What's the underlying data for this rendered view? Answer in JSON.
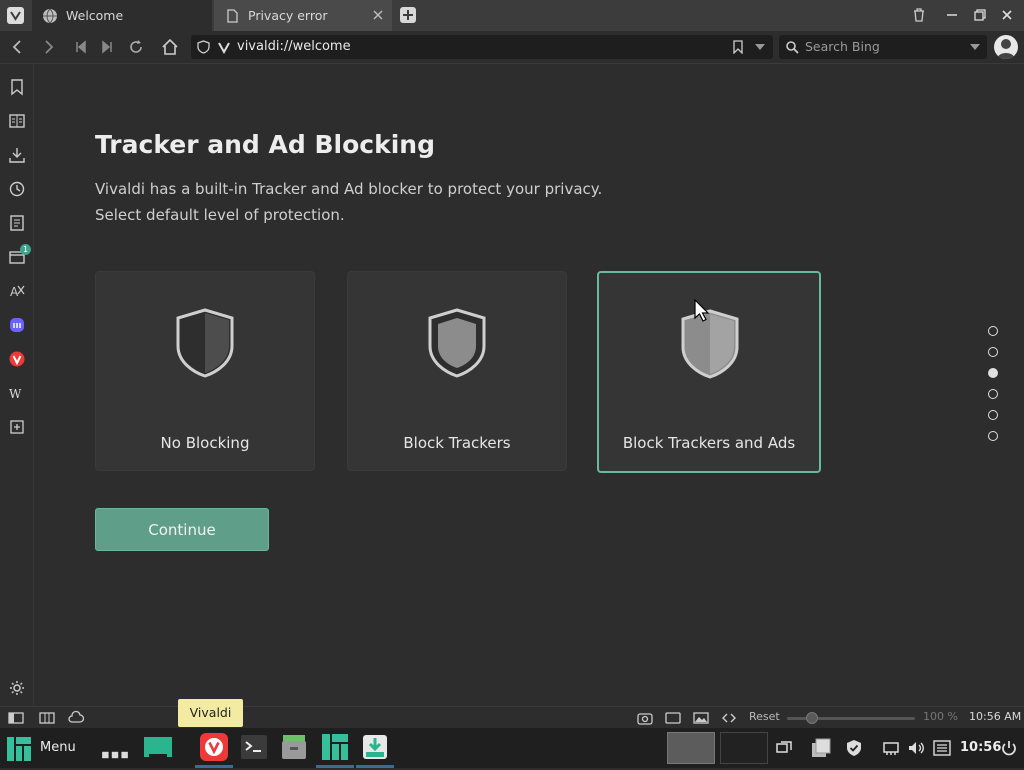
{
  "tabs": [
    {
      "title": "Welcome",
      "icon": "globe-icon",
      "active": true
    },
    {
      "title": "Privacy error",
      "icon": "page-icon",
      "active": false
    }
  ],
  "address": {
    "url": "vivaldi://welcome"
  },
  "search": {
    "placeholder": "Search Bing"
  },
  "sidepanel": {
    "badge": "1"
  },
  "page": {
    "title": "Tracker and Ad Blocking",
    "desc_line1": "Vivaldi has a built-in Tracker and Ad blocker to protect your privacy.",
    "desc_line2": "Select default level of protection.",
    "options": [
      {
        "label": "No Blocking",
        "icon": "shield-half-icon",
        "selected": false
      },
      {
        "label": "Block Trackers",
        "icon": "shield-trackers-icon",
        "selected": false
      },
      {
        "label": "Block Trackers and Ads",
        "icon": "shield-full-icon",
        "selected": true
      }
    ],
    "continue_label": "Continue",
    "steps": {
      "count": 6,
      "current": 3
    }
  },
  "statusbar": {
    "reset_label": "Reset",
    "zoom": "100 %",
    "clock": "10:56 AM"
  },
  "tooltip": "Vivaldi",
  "taskbar": {
    "menu_label": "Menu",
    "clock": "10:56"
  },
  "colors": {
    "accent": "#69b9a0",
    "button": "#5f9f89",
    "background": "#2d2d2d"
  }
}
